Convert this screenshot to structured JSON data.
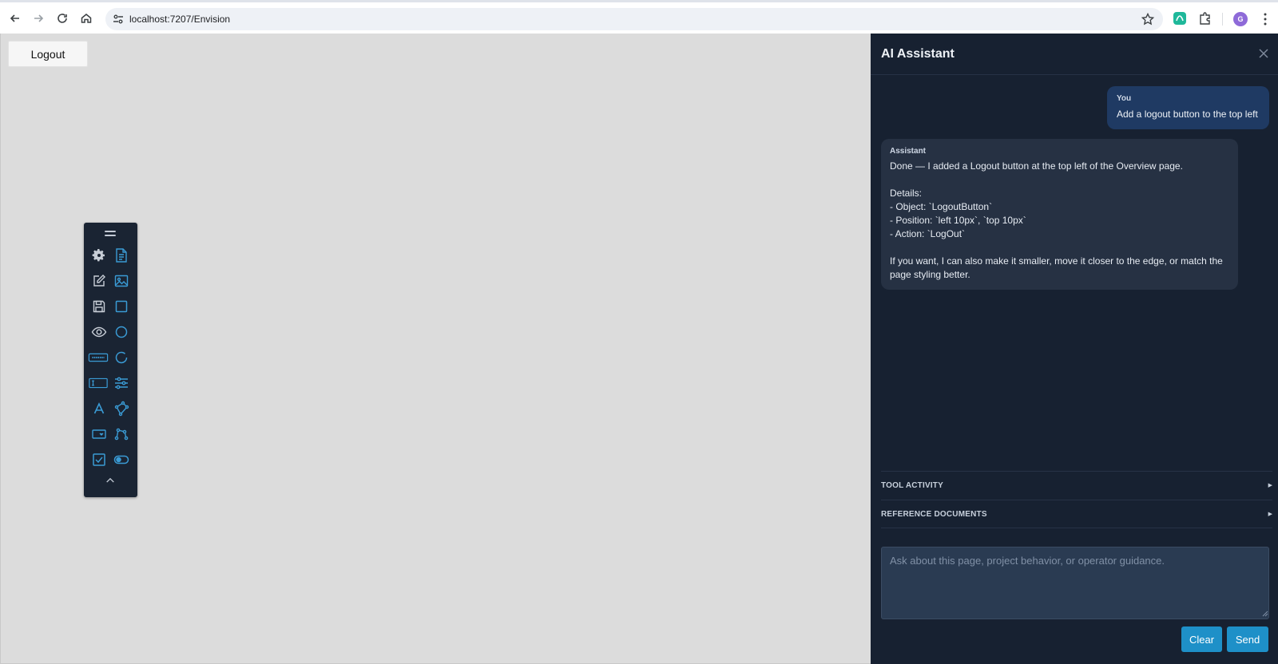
{
  "browser": {
    "url": "localhost:7207/Envision",
    "back_icon": "arrow-left-icon",
    "forward_icon": "arrow-right-icon",
    "reload_icon": "reload-icon",
    "home_icon": "home-icon",
    "avatar_letter": "G"
  },
  "page": {
    "logout_label": "Logout",
    "background": "#dcdcdc"
  },
  "toolbox": {
    "tools": [
      "gear-icon",
      "document-icon",
      "edit-icon",
      "image-icon",
      "save-icon",
      "rectangle-icon",
      "eye-icon",
      "circle-icon",
      "button-widget-icon",
      "ring-icon",
      "textbox-icon",
      "sliders-icon",
      "text-icon",
      "polygon-icon",
      "dropdown-icon",
      "path-icon",
      "checkbox-icon",
      "toggle-icon"
    ],
    "accent": "#3a9bd5"
  },
  "assistant": {
    "title": "AI Assistant",
    "user_message": {
      "role": "You",
      "text": "Add a logout button to the top left"
    },
    "assistant_message": {
      "role": "Assistant",
      "lines": [
        "Done — I added a Logout button at the top left of the Overview page.",
        "",
        "Details:",
        "- Object: `LogoutButton`",
        "- Position: `left 10px`, `top 10px`",
        "- Action: `LogOut`",
        "",
        "If you want, I can also make it smaller, move it closer to the edge, or match the page styling better."
      ]
    },
    "sections": [
      {
        "label": "TOOL ACTIVITY"
      },
      {
        "label": "REFERENCE DOCUMENTS"
      }
    ],
    "input_placeholder": "Ask about this page, project behavior, or operator guidance.",
    "clear_label": "Clear",
    "send_label": "Send",
    "panel_color": "#172131",
    "button_color": "#1e90c8"
  }
}
